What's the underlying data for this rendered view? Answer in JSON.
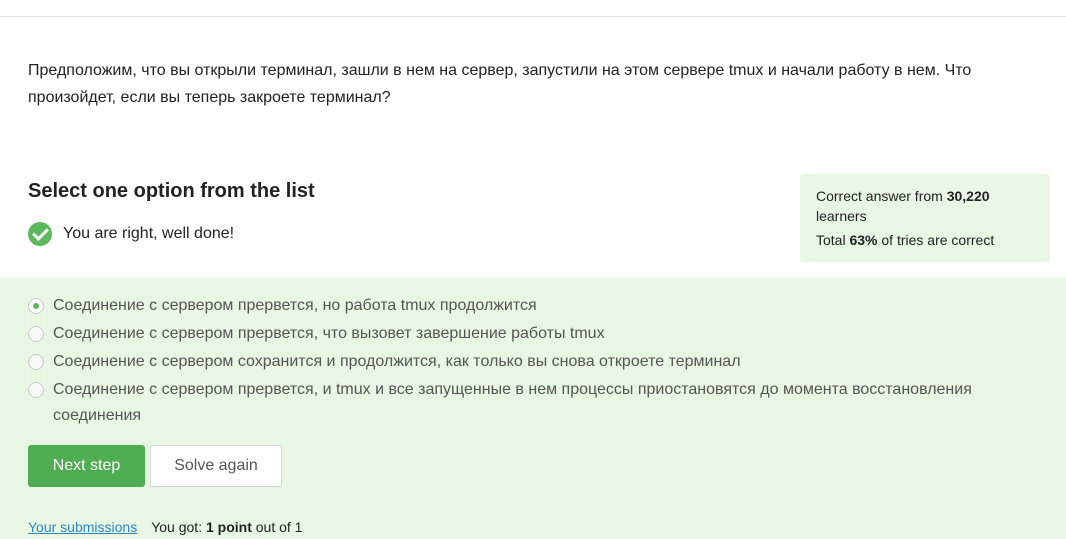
{
  "question": {
    "text": "Предположим, что вы открыли терминал, зашли в нем на сервер, запустили на этом сервере tmux и начали работу в нем. Что произойдет, если вы теперь закроете терминал?"
  },
  "section_title": "Select one option from the list",
  "result": {
    "message": "You are right, well done!",
    "icon": "check-circle-icon",
    "color": "#5cb85c"
  },
  "stats": {
    "correct_prefix": "Correct answer from ",
    "learners_count": "30,220",
    "learners_suffix": "learners",
    "total_prefix": "Total ",
    "percent": "63%",
    "total_suffix": " of tries are correct"
  },
  "options": [
    {
      "label": "Соединение с сервером прервется, но работа tmux продолжится",
      "selected": true
    },
    {
      "label": "Соединение с сервером прервется, что вызовет завершение работы tmux",
      "selected": false
    },
    {
      "label": "Соединение с сервером сохранится и продолжится, как только вы снова откроете терминал",
      "selected": false
    },
    {
      "label": "Соединение с сервером прервется, и tmux и все запущенные в нем процессы приостановятся до момента восстановления соединения",
      "selected": false
    }
  ],
  "buttons": {
    "next_step": "Next step",
    "solve_again": "Solve again"
  },
  "footer": {
    "submissions_link": "Your submissions",
    "got_prefix": "You got: ",
    "points": "1 point",
    "got_suffix": " out of 1"
  },
  "colors": {
    "accent_green": "#51ad53",
    "panel_green": "#e8f6e4",
    "link_blue": "#2e86c1"
  }
}
